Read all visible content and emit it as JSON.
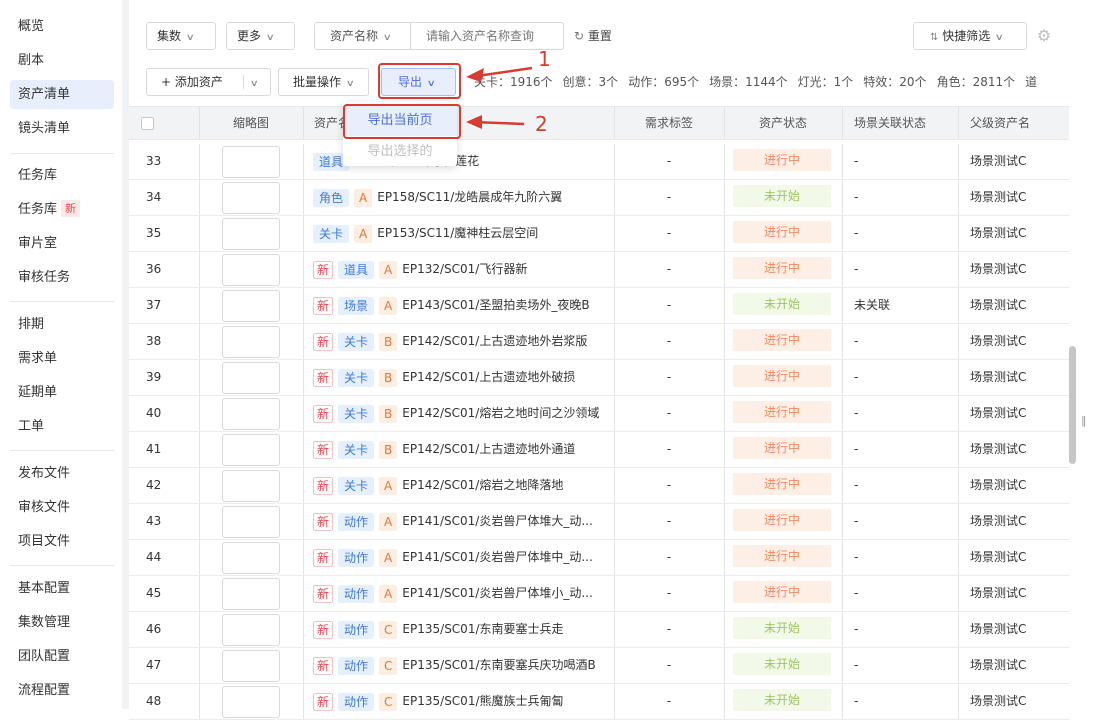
{
  "sidebar": {
    "items": [
      {
        "label": "概览"
      },
      {
        "label": "剧本"
      },
      {
        "label": "资产清单"
      },
      {
        "label": "镜头清单"
      },
      {
        "label": "任务库"
      },
      {
        "label": "任务库"
      },
      {
        "label": "审片室"
      },
      {
        "label": "审核任务"
      },
      {
        "label": "排期"
      },
      {
        "label": "需求单"
      },
      {
        "label": "延期单"
      },
      {
        "label": "工单"
      },
      {
        "label": "发布文件"
      },
      {
        "label": "审核文件"
      },
      {
        "label": "项目文件"
      },
      {
        "label": "基本配置"
      },
      {
        "label": "集数管理"
      },
      {
        "label": "团队配置"
      },
      {
        "label": "流程配置"
      }
    ],
    "new_badge": "新",
    "active_index": 2
  },
  "filters": {
    "episode": "集数",
    "more": "更多",
    "field_select": "资产名称",
    "search_placeholder": "请输入资产名称查询",
    "reset": "重置",
    "quick_filter": "快捷筛选"
  },
  "actions": {
    "add_asset": "添加资产",
    "batch": "批量操作",
    "export": "导出"
  },
  "stats": [
    "关卡：1916个",
    "创意：3个",
    "动作：695个",
    "场景：1144个",
    "灯光：1个",
    "特效：20个",
    "角色：2811个",
    "道"
  ],
  "export_menu": {
    "current_page": "导出当前页",
    "selected": "导出选择的"
  },
  "annotations": {
    "one": "1",
    "two": "2"
  },
  "table": {
    "columns": [
      "缩略图",
      "资产名",
      "需求标签",
      "资产状态",
      "场景关联状态",
      "父级资产名"
    ],
    "rows": [
      {
        "idx": "33",
        "new": "",
        "type": "道具",
        "level": "",
        "path": "EP153/SC11/净化莲花",
        "req": "-",
        "status": "进行中",
        "link": "-",
        "parent": "场景测试C"
      },
      {
        "idx": "34",
        "new": "",
        "type": "角色",
        "level": "A",
        "path": "EP158/SC11/龙皓晨成年九阶六翼",
        "req": "-",
        "status": "未开始",
        "link": "-",
        "parent": "场景测试C"
      },
      {
        "idx": "35",
        "new": "",
        "type": "关卡",
        "level": "A",
        "path": "EP153/SC11/魔神柱云层空间",
        "req": "-",
        "status": "进行中",
        "link": "-",
        "parent": "场景测试C"
      },
      {
        "idx": "36",
        "new": "新",
        "type": "道具",
        "level": "A",
        "path": "EP132/SC01/飞行器新",
        "req": "-",
        "status": "进行中",
        "link": "-",
        "parent": "场景测试C"
      },
      {
        "idx": "37",
        "new": "新",
        "type": "场景",
        "level": "A",
        "path": "EP143/SC01/圣盟拍卖场外_夜晚B",
        "req": "-",
        "status": "未开始",
        "link": "未关联",
        "parent": "场景测试C"
      },
      {
        "idx": "38",
        "new": "新",
        "type": "关卡",
        "level": "B",
        "path": "EP142/SC01/上古遗迹地外岩浆版",
        "req": "-",
        "status": "进行中",
        "link": "-",
        "parent": "场景测试C"
      },
      {
        "idx": "39",
        "new": "新",
        "type": "关卡",
        "level": "B",
        "path": "EP142/SC01/上古遗迹地外破损",
        "req": "-",
        "status": "进行中",
        "link": "-",
        "parent": "场景测试C"
      },
      {
        "idx": "40",
        "new": "新",
        "type": "关卡",
        "level": "B",
        "path": "EP142/SC01/熔岩之地时间之沙领域",
        "req": "-",
        "status": "进行中",
        "link": "-",
        "parent": "场景测试C"
      },
      {
        "idx": "41",
        "new": "新",
        "type": "关卡",
        "level": "B",
        "path": "EP142/SC01/上古遗迹地外通道",
        "req": "-",
        "status": "进行中",
        "link": "-",
        "parent": "场景测试C"
      },
      {
        "idx": "42",
        "new": "新",
        "type": "关卡",
        "level": "A",
        "path": "EP142/SC01/熔岩之地降落地",
        "req": "-",
        "status": "进行中",
        "link": "-",
        "parent": "场景测试C"
      },
      {
        "idx": "43",
        "new": "新",
        "type": "动作",
        "level": "A",
        "path": "EP141/SC01/炎岩兽尸体堆大_动...",
        "req": "-",
        "status": "进行中",
        "link": "-",
        "parent": "场景测试C"
      },
      {
        "idx": "44",
        "new": "新",
        "type": "动作",
        "level": "A",
        "path": "EP141/SC01/炎岩兽尸体堆中_动...",
        "req": "-",
        "status": "进行中",
        "link": "-",
        "parent": "场景测试C"
      },
      {
        "idx": "45",
        "new": "新",
        "type": "动作",
        "level": "A",
        "path": "EP141/SC01/炎岩兽尸体堆小_动...",
        "req": "-",
        "status": "进行中",
        "link": "-",
        "parent": "场景测试C"
      },
      {
        "idx": "46",
        "new": "新",
        "type": "动作",
        "level": "C",
        "path": "EP135/SC01/东南要塞士兵走",
        "req": "-",
        "status": "未开始",
        "link": "-",
        "parent": "场景测试C"
      },
      {
        "idx": "47",
        "new": "新",
        "type": "动作",
        "level": "C",
        "path": "EP135/SC01/东南要塞兵庆功喝酒B",
        "req": "-",
        "status": "未开始",
        "link": "-",
        "parent": "场景测试C"
      },
      {
        "idx": "48",
        "new": "新",
        "type": "动作",
        "level": "C",
        "path": "EP135/SC01/熊魔族士兵匍匐",
        "req": "-",
        "status": "未开始",
        "link": "-",
        "parent": "场景测试C"
      }
    ]
  },
  "colors": {
    "accent": "#4a6fd8",
    "annotation_red": "#d93a32",
    "status_in_progress_text": "#f08a5d",
    "status_in_progress_bg": "#fdeee6",
    "status_not_started_text": "#9cc65f",
    "status_not_started_bg": "#f3f9e8"
  }
}
